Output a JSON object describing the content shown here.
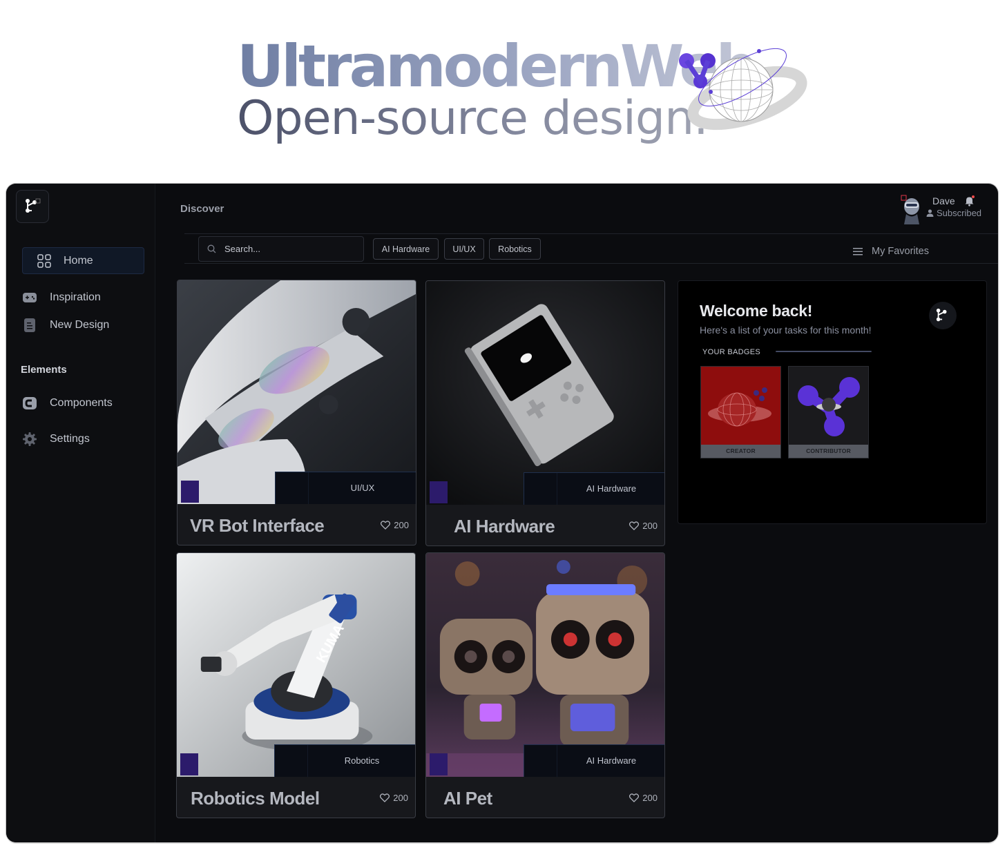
{
  "hero": {
    "title": "UltramodernWeb",
    "subtitle": "Open-source design."
  },
  "sidebar": {
    "items": [
      {
        "label": "Home",
        "icon": "grid-icon",
        "active": true
      },
      {
        "label": "Inspiration",
        "icon": "gamepad-icon"
      },
      {
        "label": "New Design",
        "icon": "document-icon"
      }
    ],
    "section_label": "Elements",
    "elements": [
      {
        "label": "Components",
        "icon": "component-icon"
      },
      {
        "label": "Settings",
        "icon": "gear-icon"
      }
    ]
  },
  "header": {
    "title": "Discover",
    "user": {
      "name": "Dave",
      "status": "Subscribed"
    }
  },
  "toolbar": {
    "search_placeholder": "Search...",
    "filters": [
      "AI Hardware",
      "UI/UX",
      "Robotics"
    ],
    "favorites_label": "My Favorites"
  },
  "cards": [
    {
      "title": "VR Bot Interface",
      "tag": "UI/UX",
      "likes": "200"
    },
    {
      "title": "AI Hardware",
      "tag": "AI Hardware",
      "likes": "200"
    },
    {
      "title": "Robotics Model",
      "tag": "Robotics",
      "likes": "200"
    },
    {
      "title": "AI Pet",
      "tag": "AI Hardware",
      "likes": "200"
    }
  ],
  "welcome": {
    "title": "Welcome back!",
    "subtitle": "Here's a list of your tasks for this month!",
    "badges_label": "YOUR BADGES",
    "badges": [
      {
        "label": "CREATOR"
      },
      {
        "label": "CONTRIBUTOR"
      }
    ]
  },
  "colors": {
    "accent": "#5b3fd6",
    "app_background": "#0b0c0f",
    "creator_badge": "#8e0d0d",
    "tag_square": "#2c1b6b"
  }
}
